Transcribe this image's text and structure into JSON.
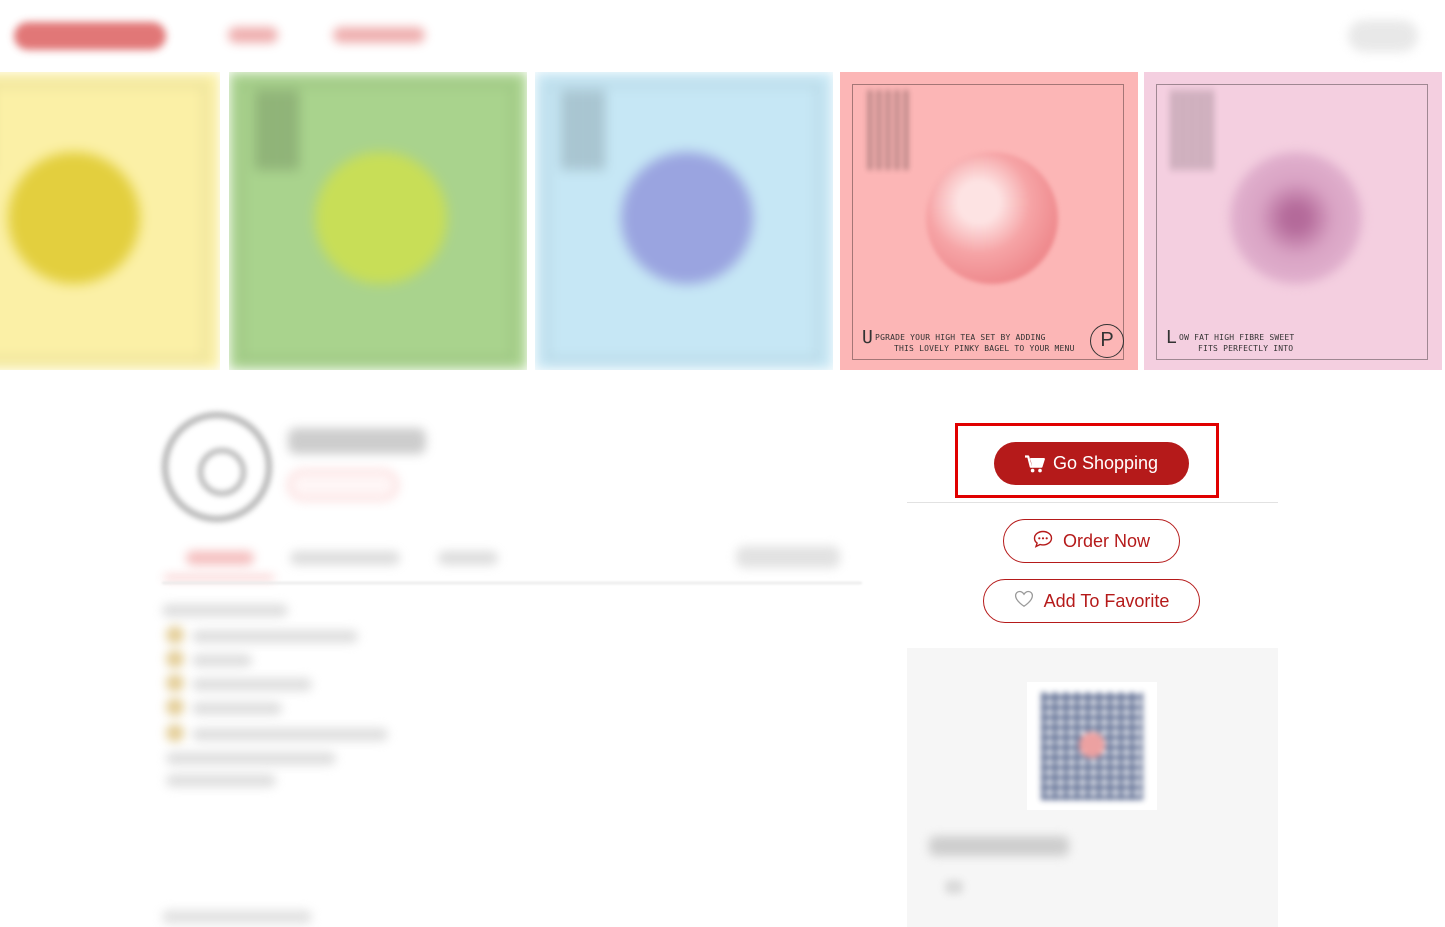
{
  "colors": {
    "brand_red": "#b51a1a",
    "highlight_red": "#e00000",
    "tile_yellow": "#fbf0a6",
    "tile_green": "#a9d38d",
    "tile_blue": "#c6e7f5",
    "tile_pink": "#fcb6b6",
    "tile_mauve": "#f4cfe0"
  },
  "banner": {
    "tiles": [
      {
        "color": "#fbf0a6",
        "donut": "#e3cf3e"
      },
      {
        "color": "#a9d38d",
        "donut": "#c8de57"
      },
      {
        "color": "#c6e7f5",
        "donut": "#9aa4e0"
      },
      {
        "color": "#fcb6b6",
        "donut": "#f08f92",
        "caption_first": "U",
        "caption_line1": "PGRADE YOUR HIGH TEA SET BY ADDING",
        "caption_line2": "THIS LOVELY PINKY BAGEL TO YOUR MENU",
        "stamp": "P"
      },
      {
        "color": "#f4cfe0",
        "donut": "#d9a3c4",
        "caption_first": "L",
        "caption_line1": "OW FAT HIGH FIBRE SWEET",
        "caption_line2": "FITS PERFECTLY INTO"
      }
    ]
  },
  "actions": {
    "go_shopping": "Go Shopping",
    "order_now": "Order Now",
    "add_to_favorite": "Add To Favorite"
  },
  "icons": {
    "go_shopping": "cart-icon",
    "order_now": "chat-icon",
    "add_to_favorite": "heart-icon"
  }
}
